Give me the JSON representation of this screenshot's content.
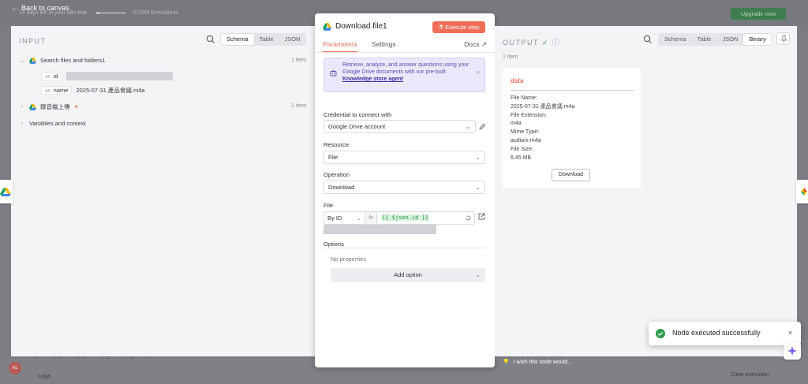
{
  "background": {
    "trial_text": "14 days left in your n8n trial",
    "executions_text": "0/1000 Executions",
    "upgrade_label": "Upgrade now",
    "logs_label": "Logs",
    "clear_label": "Clear execution",
    "avatar_initials": "AL"
  },
  "back_label": "Back to canvas",
  "input": {
    "title": "INPUT",
    "views": [
      "Schema",
      "Table",
      "JSON"
    ],
    "active_view": "Schema",
    "nodes": [
      {
        "name": "Search files and folders1",
        "count": "1 item",
        "fields": [
          {
            "type": "AB",
            "key": "id",
            "value": ""
          },
          {
            "type": "AB",
            "key": "name",
            "value": "2025-07-31 產品會議.m4a"
          }
        ]
      },
      {
        "name": "錄音檔上傳",
        "count": "1 item"
      }
    ],
    "variables_label": "Variables and context"
  },
  "node": {
    "title": "Download file1",
    "execute_label": "Execute step",
    "tabs": [
      "Parameters",
      "Settings"
    ],
    "active_tab": "Parameters",
    "docs_label": "Docs",
    "callout_text": "Retrieve, analyze, and answer questions using your Google Drive documents with our pre-built ",
    "callout_link": "Knowledge store agent",
    "credential_label": "Credential to connect with",
    "credential_value": "Google Drive account",
    "resource_label": "Resource",
    "resource_value": "File",
    "operation_label": "Operation",
    "operation_value": "Download",
    "file_label": "File",
    "file_mode": "By ID",
    "fx_label": "fx",
    "file_expression": "{{ $json.id }}",
    "options_label": "Options",
    "no_properties": "No properties",
    "add_option_label": "Add option"
  },
  "output": {
    "title": "OUTPUT",
    "views": [
      "Schema",
      "Table",
      "JSON",
      "Binary"
    ],
    "active_view": "Binary",
    "count": "1 item",
    "binary": {
      "key": "data",
      "file_name_label": "File Name:",
      "file_name": "2025-07-31 產品會議.m4a",
      "ext_label": "File Extension:",
      "ext": "m4a",
      "mime_label": "Mime Type:",
      "mime": "audio/x-m4a",
      "size_label": "File Size:",
      "size": "6.45 MB",
      "download_label": "Download"
    }
  },
  "wish_text": "I wish this node would...",
  "toast": {
    "message": "Node executed successfully"
  },
  "colors": {
    "accent": "#ec6e58",
    "success": "#2e9e4f"
  }
}
